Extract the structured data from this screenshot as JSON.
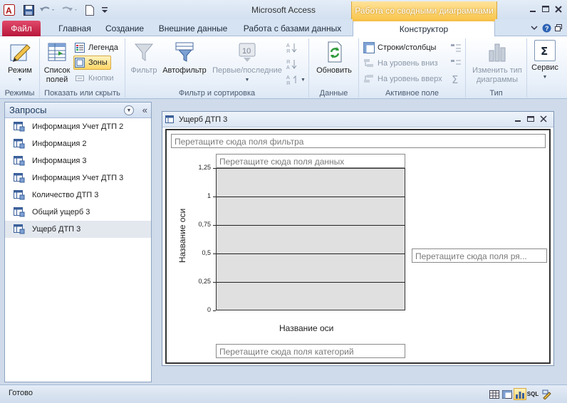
{
  "app": {
    "title": "Microsoft Access",
    "context_tab_header": "Работа со сводными диаграммами"
  },
  "tabs": {
    "file": "Файл",
    "home": "Главная",
    "create": "Создание",
    "external": "Внешние данные",
    "database": "Работа с базами данных",
    "design": "Конструктор"
  },
  "ribbon": {
    "groups": {
      "modes": "Режимы",
      "show_hide": "Показать или скрыть",
      "filter_sort": "Фильтр и сортировка",
      "data": "Данные",
      "active_field": "Активное поле",
      "type": "Тип"
    },
    "buttons": {
      "mode": "Режим",
      "field_list_1": "Список",
      "field_list_2": "полей",
      "legend": "Легенда",
      "zones": "Зоны",
      "buttons": "Кнопки",
      "filter": "Фильтр",
      "autofilter": "Автофильтр",
      "top_bottom": "Первые/последние",
      "refresh": "Обновить",
      "rows_cols": "Строки/столбцы",
      "level_down": "На уровень вниз",
      "level_up": "На уровень вверх",
      "change_type_1": "Изменить тип",
      "change_type_2": "диаграммы",
      "service": "Сервис"
    }
  },
  "nav": {
    "title": "Запросы",
    "items": [
      {
        "label": "Информация Учет ДТП 2",
        "selected": false
      },
      {
        "label": "Информация 2",
        "selected": false
      },
      {
        "label": "Информация 3",
        "selected": false
      },
      {
        "label": "Информация Учет ДТП 3",
        "selected": false
      },
      {
        "label": "Количество ДТП 3",
        "selected": false
      },
      {
        "label": "Общий ущерб 3",
        "selected": false
      },
      {
        "label": "Ущерб ДТП 3",
        "selected": true
      }
    ]
  },
  "document": {
    "title": "Ущерб ДТП 3",
    "filter_zone": "Перетащите сюда поля фильтра",
    "data_zone": "Перетащите сюда поля данных",
    "series_zone": "Перетащите сюда поля ря...",
    "category_zone": "Перетащите сюда поля категорий"
  },
  "chart_data": {
    "type": "bar",
    "categories": [],
    "series": [],
    "xlabel": "Название оси",
    "ylabel": "Название оси",
    "ylim": [
      0,
      1.25
    ],
    "yticks": [
      "0",
      "0,25",
      "0,5",
      "0,75",
      "1",
      "1,25"
    ],
    "grid": true
  },
  "status": {
    "text": "Готово",
    "view_sql": "SQL"
  },
  "colors": {
    "file_tab": "#c41a3f",
    "context_tab": "#f9c64e",
    "plot_bg": "#e0e0e0"
  }
}
